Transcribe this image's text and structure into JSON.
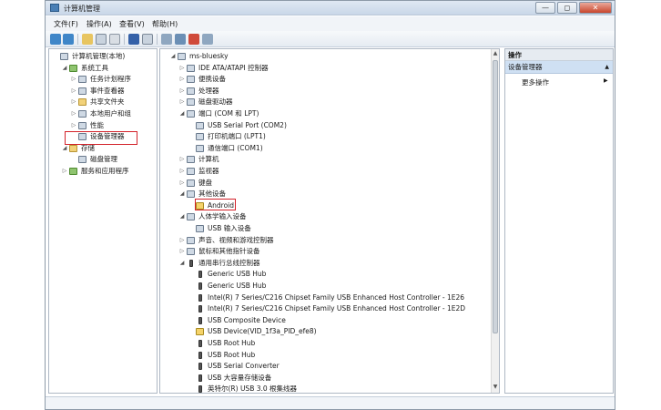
{
  "window": {
    "title": "计算机管理",
    "buttons": [
      "—",
      "◻",
      "✕"
    ]
  },
  "menu": [
    "文件(F)",
    "操作(A)",
    "查看(V)",
    "帮助(H)"
  ],
  "left_tree": [
    {
      "label": "计算机管理(本地)",
      "level": 0,
      "expander": "",
      "icon": "computer-icon"
    },
    {
      "label": "系统工具",
      "level": 1,
      "expander": "◢",
      "icon": "tools-icon"
    },
    {
      "label": "任务计划程序",
      "level": 2,
      "expander": "▷",
      "icon": "clock-icon"
    },
    {
      "label": "事件查看器",
      "level": 2,
      "expander": "▷",
      "icon": "event-icon"
    },
    {
      "label": "共享文件夹",
      "level": 2,
      "expander": "▷",
      "icon": "folder-icon"
    },
    {
      "label": "本地用户和组",
      "level": 2,
      "expander": "▷",
      "icon": "users-icon"
    },
    {
      "label": "性能",
      "level": 2,
      "expander": "▷",
      "icon": "performance-icon"
    },
    {
      "label": "设备管理器",
      "level": 2,
      "expander": "",
      "icon": "device-manager-icon"
    },
    {
      "label": "存储",
      "level": 1,
      "expander": "◢",
      "icon": "storage-icon"
    },
    {
      "label": "磁盘管理",
      "level": 2,
      "expander": "",
      "icon": "disk-icon"
    },
    {
      "label": "服务和应用程序",
      "level": 1,
      "expander": "▷",
      "icon": "services-icon"
    }
  ],
  "device_tree": [
    {
      "label": "ms-bluesky",
      "level": 0,
      "expander": "◢",
      "icon": "computer-icon"
    },
    {
      "label": "IDE ATA/ATAPI 控制器",
      "level": 1,
      "expander": "▷",
      "icon": "ide-icon"
    },
    {
      "label": "便携设备",
      "level": 1,
      "expander": "▷",
      "icon": "portable-icon"
    },
    {
      "label": "处理器",
      "level": 1,
      "expander": "▷",
      "icon": "cpu-icon"
    },
    {
      "label": "磁盘驱动器",
      "level": 1,
      "expander": "▷",
      "icon": "disk-icon"
    },
    {
      "label": "端口 (COM 和 LPT)",
      "level": 1,
      "expander": "◢",
      "icon": "port-icon"
    },
    {
      "label": "USB Serial Port (COM2)",
      "level": 2,
      "expander": "",
      "icon": "port-icon"
    },
    {
      "label": "打印机端口 (LPT1)",
      "level": 2,
      "expander": "",
      "icon": "port-icon"
    },
    {
      "label": "通信端口 (COM1)",
      "level": 2,
      "expander": "",
      "icon": "port-icon"
    },
    {
      "label": "计算机",
      "level": 1,
      "expander": "▷",
      "icon": "computer-icon"
    },
    {
      "label": "监视器",
      "level": 1,
      "expander": "▷",
      "icon": "monitor-icon"
    },
    {
      "label": "键盘",
      "level": 1,
      "expander": "▷",
      "icon": "keyboard-icon"
    },
    {
      "label": "其他设备",
      "level": 1,
      "expander": "◢",
      "icon": "other-devices-icon"
    },
    {
      "label": "Android",
      "level": 2,
      "expander": "",
      "icon": "warning-device-icon"
    },
    {
      "label": "人体学输入设备",
      "level": 1,
      "expander": "◢",
      "icon": "hid-icon"
    },
    {
      "label": "USB 输入设备",
      "level": 2,
      "expander": "",
      "icon": "hid-icon"
    },
    {
      "label": "声音、视频和游戏控制器",
      "level": 1,
      "expander": "▷",
      "icon": "sound-icon"
    },
    {
      "label": "鼠标和其他指针设备",
      "level": 1,
      "expander": "▷",
      "icon": "mouse-icon"
    },
    {
      "label": "通用串行总线控制器",
      "level": 1,
      "expander": "◢",
      "icon": "usb-icon"
    },
    {
      "label": "Generic USB Hub",
      "level": 2,
      "expander": "",
      "icon": "usb-icon"
    },
    {
      "label": "Generic USB Hub",
      "level": 2,
      "expander": "",
      "icon": "usb-icon"
    },
    {
      "label": "Intel(R) 7 Series/C216 Chipset Family USB Enhanced Host Controller - 1E26",
      "level": 2,
      "expander": "",
      "icon": "usb-icon"
    },
    {
      "label": "Intel(R) 7 Series/C216 Chipset Family USB Enhanced Host Controller - 1E2D",
      "level": 2,
      "expander": "",
      "icon": "usb-icon"
    },
    {
      "label": "USB Composite Device",
      "level": 2,
      "expander": "",
      "icon": "usb-icon"
    },
    {
      "label": "USB Device(VID_1f3a_PID_efe8)",
      "level": 2,
      "expander": "",
      "icon": "warning-usb-icon"
    },
    {
      "label": "USB Root Hub",
      "level": 2,
      "expander": "",
      "icon": "usb-icon"
    },
    {
      "label": "USB Root Hub",
      "level": 2,
      "expander": "",
      "icon": "usb-icon"
    },
    {
      "label": "USB Serial Converter",
      "level": 2,
      "expander": "",
      "icon": "usb-icon"
    },
    {
      "label": "USB 大容量存储设备",
      "level": 2,
      "expander": "",
      "icon": "usb-icon"
    },
    {
      "label": "英特尔(R) USB 3.0 根集线器",
      "level": 2,
      "expander": "",
      "icon": "usb-icon"
    }
  ],
  "actions": {
    "header": "操作",
    "selected": "设备管理器",
    "more": "更多操作"
  },
  "colors": {
    "highlight_box": "#d3222a",
    "selection": "#cfe0f3"
  }
}
